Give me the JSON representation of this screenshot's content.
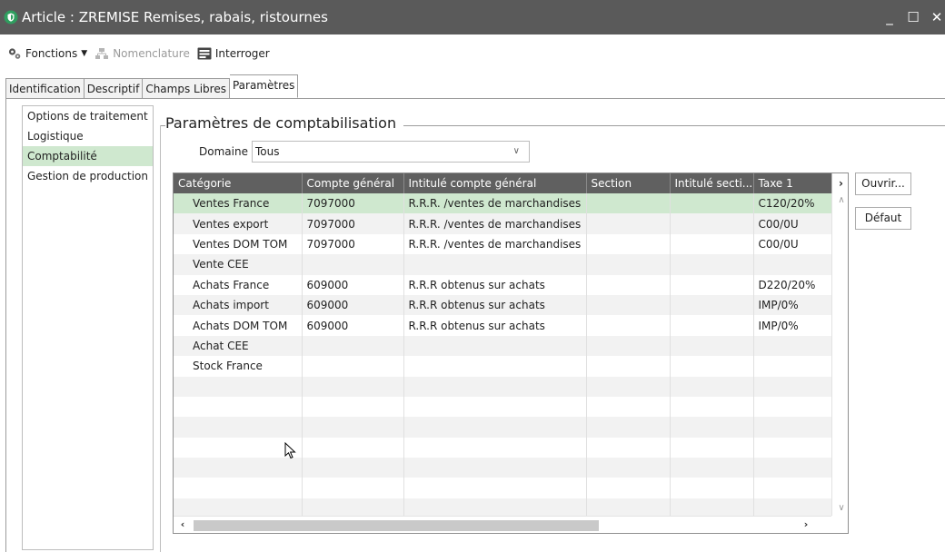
{
  "window": {
    "title": "Article : ZREMISE Remises, rabais, ristournes",
    "icon": "shield-icon",
    "controls": {
      "minimize": "_",
      "maximize": "☐",
      "close": "✕"
    }
  },
  "toolbar": {
    "fonctions_label": "Fonctions",
    "nomenclature_label": "Nomenclature",
    "interroger_label": "Interroger"
  },
  "tabs": [
    {
      "label": "Identification",
      "active": false
    },
    {
      "label": "Descriptif",
      "active": false
    },
    {
      "label": "Champs Libres",
      "active": false
    },
    {
      "label": "Paramètres",
      "active": true
    }
  ],
  "left_nav": {
    "items": [
      {
        "label": "Options de traitement",
        "selected": false
      },
      {
        "label": "Logistique",
        "selected": false
      },
      {
        "label": "Comptabilité",
        "selected": true
      },
      {
        "label": "Gestion de production",
        "selected": false
      }
    ]
  },
  "section": {
    "title": "Paramètres de comptabilisation",
    "domaine_label": "Domaine",
    "domaine_value": "Tous"
  },
  "grid": {
    "columns": [
      "Catégorie",
      "Compte général",
      "Intitulé compte général",
      "Section",
      "Intitulé secti...",
      "Taxe 1"
    ],
    "rows": [
      [
        "Ventes France",
        "7097000",
        "R.R.R. /ventes de marchandises",
        "",
        "",
        "C120/20%"
      ],
      [
        "Ventes export",
        "7097000",
        "R.R.R. /ventes de marchandises",
        "",
        "",
        "C00/0U"
      ],
      [
        "Ventes DOM TOM",
        "7097000",
        "R.R.R. /ventes de marchandises",
        "",
        "",
        "C00/0U"
      ],
      [
        "Vente CEE",
        "",
        "",
        "",
        "",
        ""
      ],
      [
        "Achats France",
        "609000",
        "R.R.R obtenus sur achats",
        "",
        "",
        "D220/20%"
      ],
      [
        "Achats import",
        "609000",
        "R.R.R obtenus sur achats",
        "",
        "",
        "IMP/0%"
      ],
      [
        "Achats DOM TOM",
        "609000",
        "R.R.R obtenus sur achats",
        "",
        "",
        "IMP/0%"
      ],
      [
        "Achat CEE",
        "",
        "",
        "",
        "",
        ""
      ],
      [
        "Stock France",
        "",
        "",
        "",
        "",
        ""
      ]
    ],
    "selected_row": 0,
    "empty_rows": 7
  },
  "buttons": {
    "ouvrir_label": "Ouvrir...",
    "defaut_label": "Défaut"
  },
  "colors": {
    "titlebar": "#5a5a5a",
    "selection": "#cfe8cf",
    "grid_header": "#606060"
  }
}
